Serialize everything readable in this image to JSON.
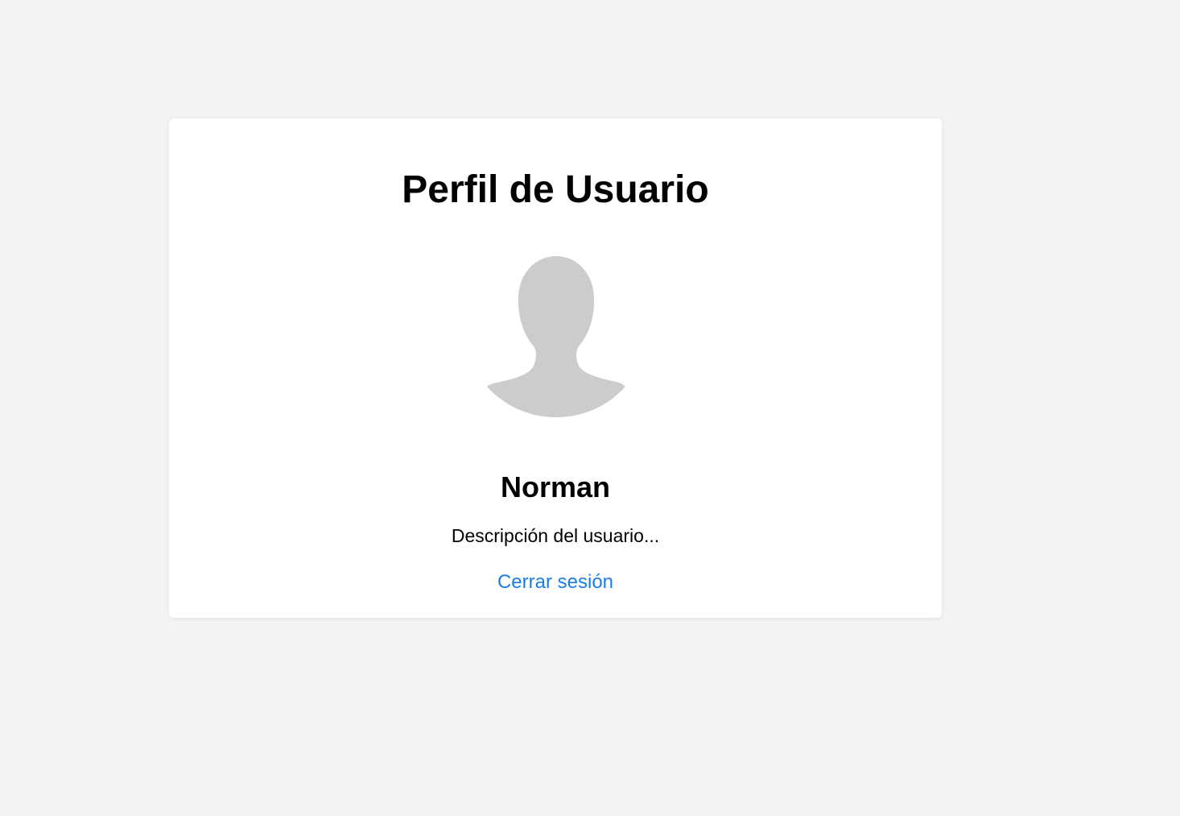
{
  "profile": {
    "title": "Perfil de Usuario",
    "avatar_icon": "user-silhouette-icon",
    "name": "Norman",
    "description": "Descripción del usuario...",
    "logout_label": "Cerrar sesión"
  },
  "colors": {
    "background": "#f3f3f3",
    "card": "#ffffff",
    "avatar": "#cccccc",
    "link": "#1a7ee6"
  }
}
